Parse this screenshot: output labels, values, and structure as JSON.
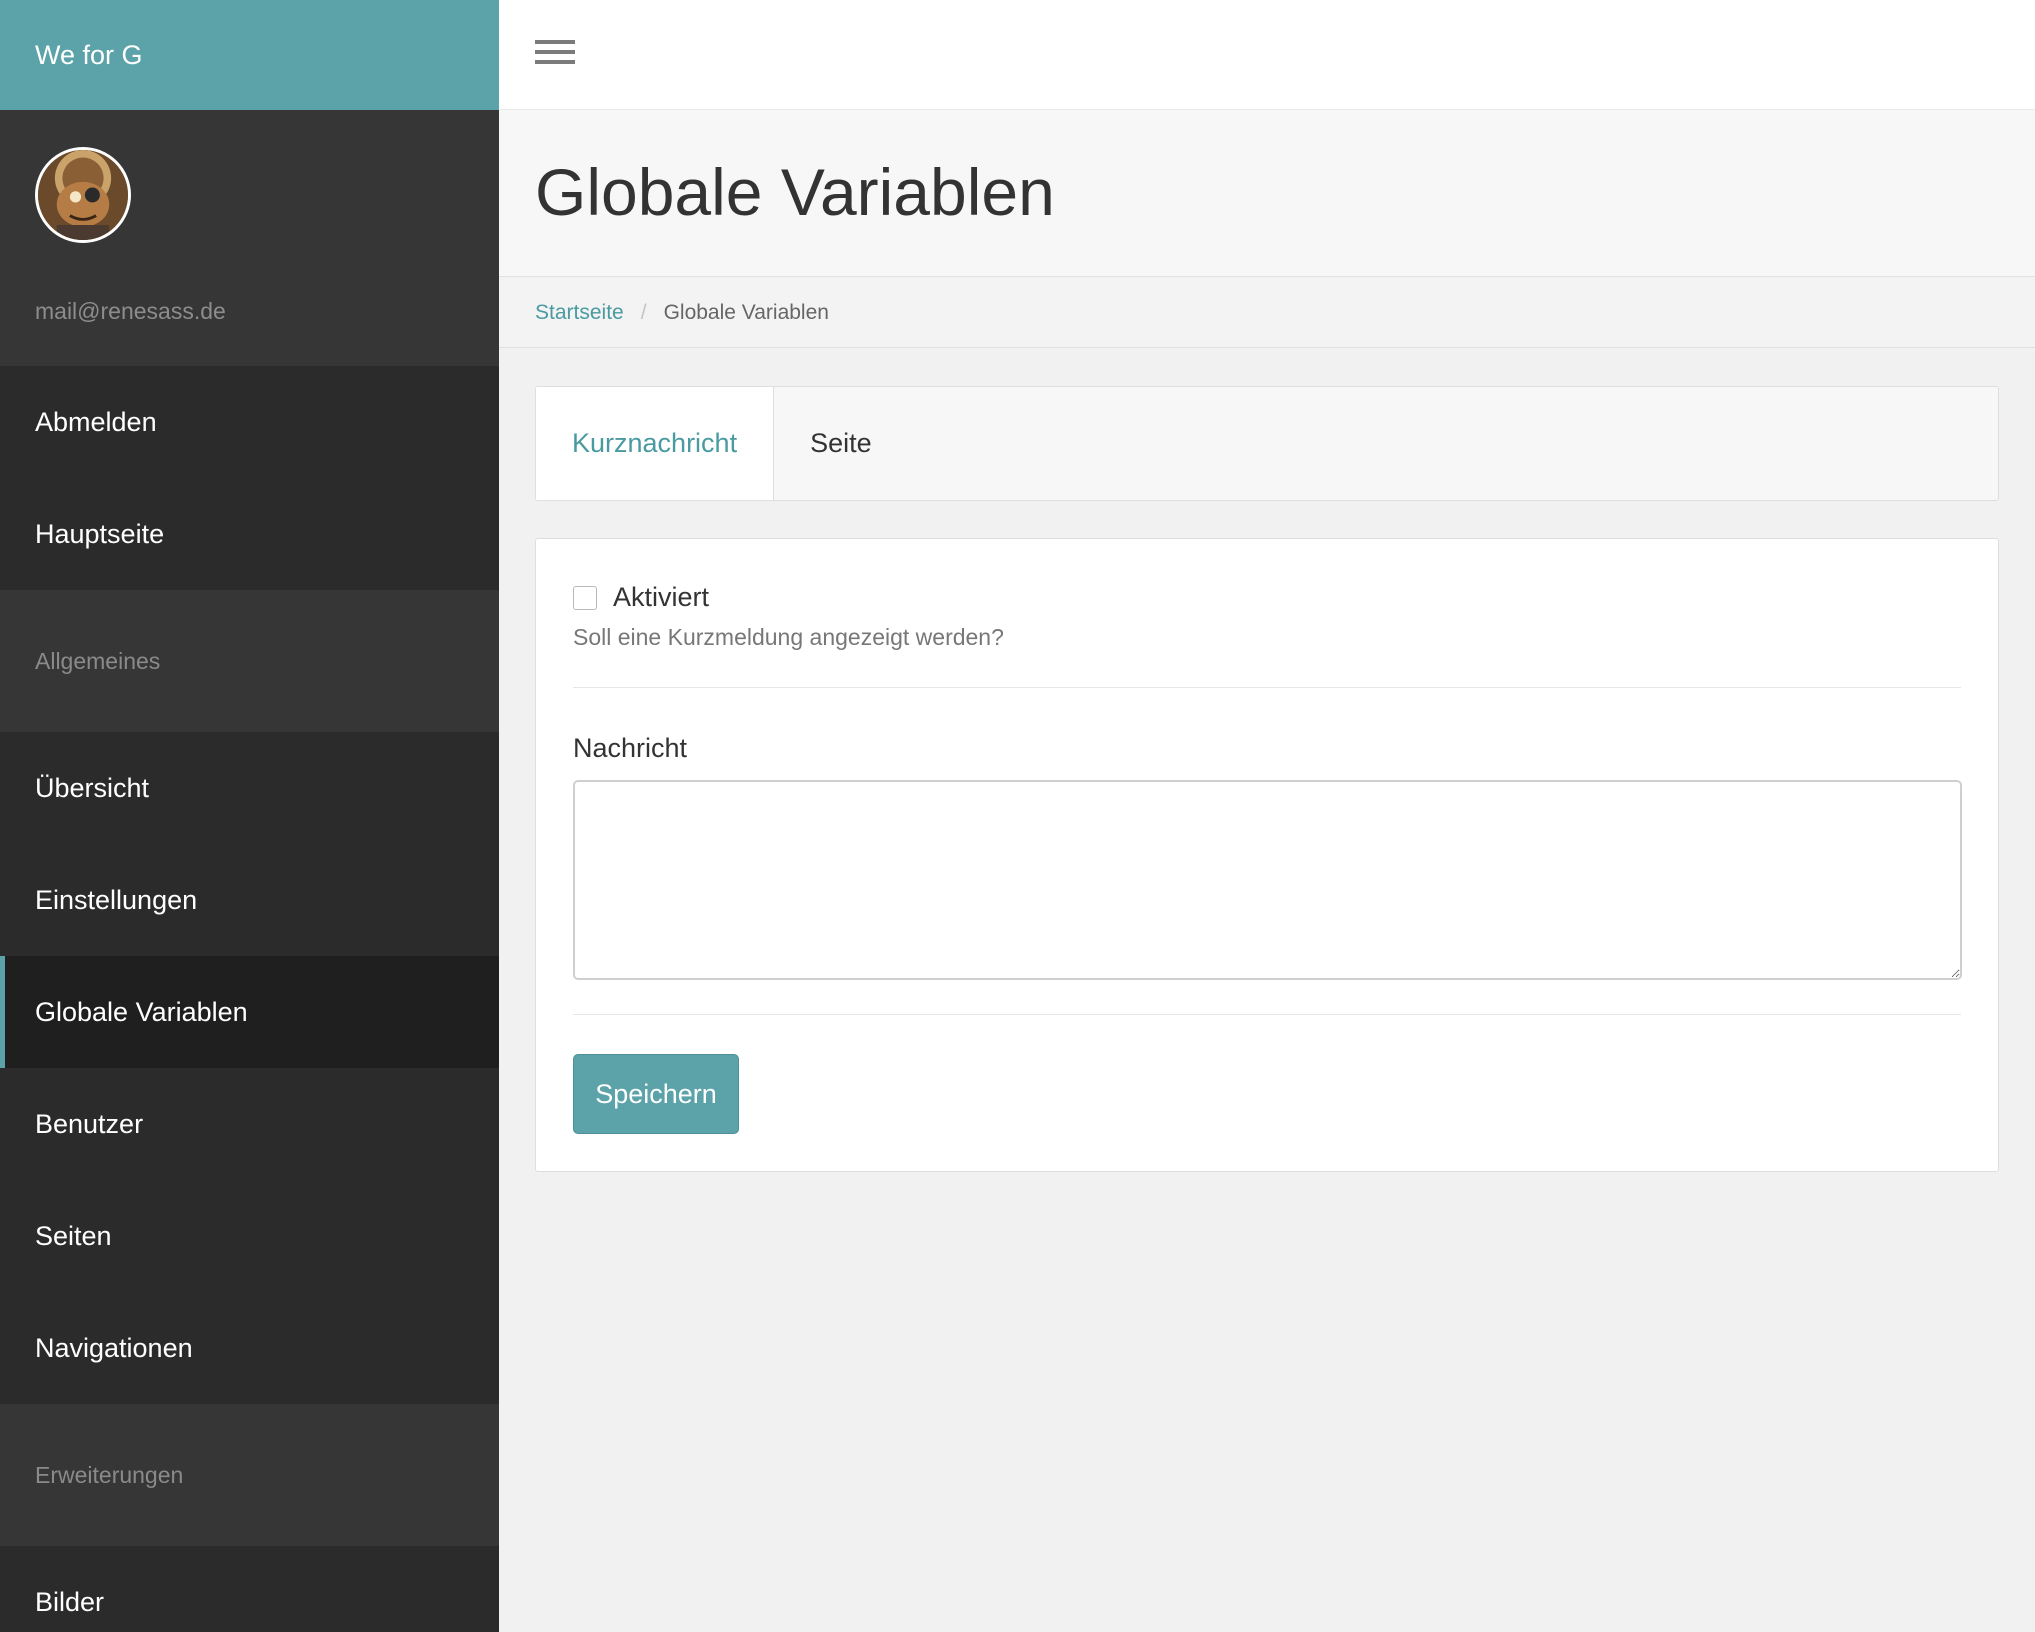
{
  "sidebar": {
    "brand": "We for G",
    "user_email": "mail@renesass.de",
    "top_items": [
      {
        "label": "Abmelden"
      },
      {
        "label": "Hauptseite"
      }
    ],
    "section_general": "Allgemeines",
    "general_items": [
      {
        "label": "Übersicht"
      },
      {
        "label": "Einstellungen"
      },
      {
        "label": "Globale Variablen",
        "active": true
      },
      {
        "label": "Benutzer"
      },
      {
        "label": "Seiten"
      },
      {
        "label": "Navigationen"
      }
    ],
    "section_extensions": "Erweiterungen",
    "extension_items": [
      {
        "label": "Bilder"
      }
    ]
  },
  "page": {
    "title": "Globale Variablen"
  },
  "breadcrumb": {
    "home": "Startseite",
    "separator": "/",
    "current": "Globale Variablen"
  },
  "tabs": [
    {
      "label": "Kurznachricht",
      "active": true
    },
    {
      "label": "Seite",
      "active": false
    }
  ],
  "form": {
    "checkbox_label": "Aktiviert",
    "checkbox_checked": false,
    "checkbox_help": "Soll eine Kurzmeldung angezeigt werden?",
    "message_label": "Nachricht",
    "message_value": "",
    "save_label": "Speichern"
  },
  "colors": {
    "accent": "#5ba3a9",
    "sidebar_bg": "#2b2b2b",
    "link": "#4a9aa1"
  },
  "icons": {
    "menu": "hamburger-menu-icon"
  }
}
